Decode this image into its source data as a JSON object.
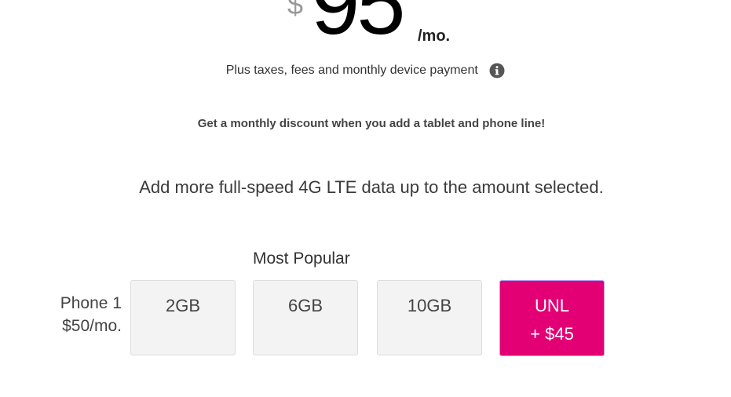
{
  "price": {
    "currency": "$",
    "amount": "95",
    "per": "/mo."
  },
  "fees": {
    "text": "Plus taxes, fees and monthly device payment",
    "icon": "info-icon"
  },
  "discount_text": "Get a monthly discount when you add a tablet and phone line!",
  "data_note": "Add more full-speed 4G LTE data up to the amount selected.",
  "most_popular_label": "Most Popular",
  "line": {
    "name": "Phone 1",
    "price": "$50/mo."
  },
  "options": [
    {
      "label": "2GB",
      "sub": ""
    },
    {
      "label": "6GB",
      "sub": ""
    },
    {
      "label": "10GB",
      "sub": ""
    },
    {
      "label": "UNL",
      "sub": "+ $45"
    }
  ],
  "selected_option": "UNL",
  "colors": {
    "accent": "#e20074",
    "option_bg": "#f3f3f3"
  }
}
